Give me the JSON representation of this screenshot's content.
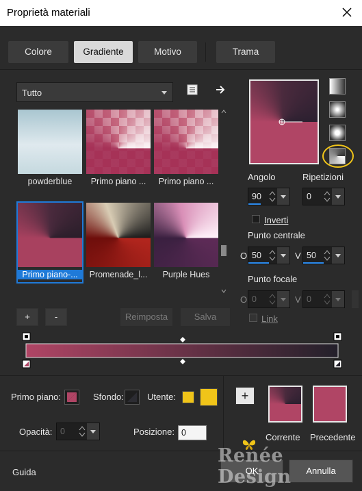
{
  "window": {
    "title": "Proprietà materiali"
  },
  "tabs": [
    {
      "label": "Colore",
      "active": false
    },
    {
      "label": "Gradiente",
      "active": true
    },
    {
      "label": "Motivo",
      "active": false
    },
    {
      "label": "Trama",
      "active": false
    }
  ],
  "library": {
    "category": "Tutto",
    "thumbnails": [
      {
        "label": "powderblue",
        "selected": false
      },
      {
        "label": "Primo piano ...",
        "selected": false
      },
      {
        "label": "Primo piano ...",
        "selected": false
      },
      {
        "label": "Primo piano-...",
        "selected": true
      },
      {
        "label": "Promenade_l...",
        "selected": false
      },
      {
        "label": "Purple Hues",
        "selected": false
      }
    ],
    "add_label": "+",
    "remove_label": "-",
    "reset_label": "Reimposta",
    "save_label": "Salva"
  },
  "gradient_settings": {
    "angle_label": "Angolo",
    "angle_value": "90",
    "repeats_label": "Ripetizioni",
    "repeats_value": "0",
    "invert_label": "Inverti",
    "center_label": "Punto centrale",
    "center_h_label": "O",
    "center_h_value": "50",
    "center_v_label": "V",
    "center_v_value": "50",
    "focal_label": "Punto focale",
    "focal_h_label": "O",
    "focal_h_value": "0",
    "focal_v_label": "V",
    "focal_v_value": "0",
    "link_label": "Link"
  },
  "bottom": {
    "foreground_label": "Primo piano:",
    "background_label": "Sfondo:",
    "user_label": "Utente:",
    "opacity_label": "Opacità:",
    "opacity_value": "0",
    "position_label": "Posizione:",
    "position_value": "0",
    "current_label": "Corrente",
    "previous_label": "Precedente",
    "add_label": "+"
  },
  "footer": {
    "help_label": "Guida",
    "ok_label": "OK",
    "cancel_label": "Annulla",
    "watermark": "Renée Design"
  },
  "colors": {
    "dark_plum": "#3a2233",
    "rose": "#b04565",
    "accent_blue": "#1f7ad8",
    "highlight_yellow": "#f0c419"
  }
}
